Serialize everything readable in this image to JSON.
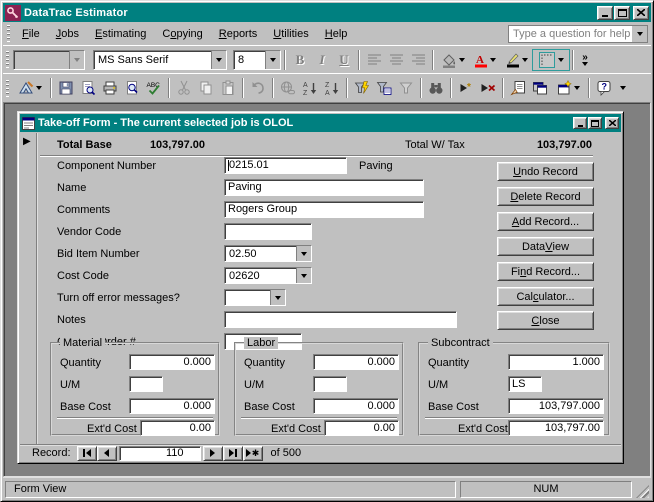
{
  "app": {
    "title": "DataTrac Estimator",
    "help_search_placeholder": "Type a question for help"
  },
  "menu": {
    "items": [
      "<u>F</u>ile",
      "<u>J</u>obs",
      "<u>E</u>stimating",
      "C<u>o</u>pying",
      "<u>R</u>eports",
      "<u>U</u>tilities",
      "<u>H</u>elp"
    ]
  },
  "formatting_toolbar": {
    "object_style_value": "",
    "font_name": "MS Sans Serif",
    "font_size": "8",
    "overflow_label": "»"
  },
  "standard_toolbar": {
    "icons": [
      "view",
      "save",
      "file-search",
      "print",
      "print-preview",
      "spelling",
      "cut",
      "copy",
      "paste",
      "undo",
      "insert-hyperlink",
      "sort-ascending",
      "sort-descending",
      "filter-by-selection",
      "filter-by-form",
      "apply-filter",
      "find",
      "new-record",
      "delete-record",
      "properties",
      "database-window",
      "new-object",
      "help",
      "toolbar-options"
    ]
  },
  "takeoff_form": {
    "title": "Take-off Form - The current selected job is OLOL",
    "totals": {
      "base_label": "Total Base",
      "base_value": "103,797.00",
      "tax_label": "Total W/ Tax",
      "tax_value": "103,797.00"
    },
    "fields": {
      "component_number": {
        "label": "Component Number",
        "value": "0215.01",
        "description": "Paving"
      },
      "name": {
        "label": "Name",
        "value": "Paving"
      },
      "comments": {
        "label": "Comments",
        "value": "Rogers Group"
      },
      "vendor_code": {
        "label": "Vendor Code",
        "value": ""
      },
      "bid_item_number": {
        "label": "Bid Item Number",
        "value": "02.50"
      },
      "cost_code": {
        "label": "Cost Code",
        "value": "02620"
      },
      "turn_off_error_messages": {
        "label": "Turn off error messages?",
        "value": ""
      },
      "notes": {
        "label": "Notes",
        "value": ""
      },
      "change_order": {
        "label": "Change Order #",
        "value": ""
      }
    },
    "buttons": {
      "undo": "<u>U</u>ndo Record",
      "delete": "<u>D</u>elete Record",
      "add": "<u>A</u>dd Record...",
      "data_view": "Data <u>V</u>iew",
      "find": "Fi<u>n</u>d Record...",
      "calculator": "Cal<u>c</u>ulator...",
      "close": "<u>C</u>lose"
    },
    "groups": [
      {
        "title": "Material",
        "labels": {
          "quantity": "Quantity",
          "um": "U/M",
          "base_cost": "Base Cost",
          "ext_cost": "Ext'd Cost"
        },
        "values": {
          "quantity": "0.000",
          "um": "",
          "base_cost": "0.000",
          "ext_cost": "0.00"
        }
      },
      {
        "title": "Labor",
        "labels": {
          "quantity": "Quantity",
          "um": "U/M",
          "base_cost": "Base Cost",
          "ext_cost": "Ext'd Cost"
        },
        "values": {
          "quantity": "0.000",
          "um": "",
          "base_cost": "0.000",
          "ext_cost": "0.00"
        }
      },
      {
        "title": "Subcontract",
        "labels": {
          "quantity": "Quantity",
          "um": "U/M",
          "base_cost": "Base Cost",
          "ext_cost": "Ext'd Cost"
        },
        "values": {
          "quantity": "1.000",
          "um": "LS",
          "base_cost": "103,797.000",
          "ext_cost": "103,797.00"
        }
      }
    ],
    "record_nav": {
      "label": "Record:",
      "current": "110",
      "count": "of 500"
    }
  },
  "status_bar": {
    "view_mode": "Form View",
    "num_lock": "NUM"
  },
  "colors": {
    "title_bar": "#008080",
    "button_face": "#c0c0c0",
    "mdi_background": "#808080",
    "font_color_swatch": "#ff0000",
    "line_color_swatch": "#000000",
    "disabled_text": "#808080"
  }
}
